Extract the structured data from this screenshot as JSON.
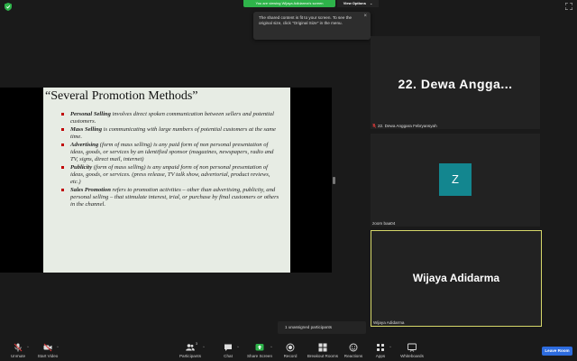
{
  "topbar": {
    "banner_text": "You are viewing Wijaya Adidarma's screen",
    "view_options_label": "View Options",
    "accent_color": "#2eb34a"
  },
  "tooltip": {
    "text": "The shared content is fit to your screen. To see the original size, click \"Original Size\" in the menu."
  },
  "slide": {
    "title": "“Several Promotion Methods”",
    "bullets": [
      {
        "term": "Personal Selling",
        "text": " involves direct spoken communication between sellers and potential customers."
      },
      {
        "term": "Mass Selling",
        "text": " is communicating with large numbers of potential customers at the same time."
      },
      {
        "term": "Advertising",
        "text": " (form of mass selling) is any paid form of non personal presentation of ideas, goods, or services by an identified sponsor (magazines, newspapers, radio and TV, signs, direct mail, internet)"
      },
      {
        "term": "Publicity",
        "text": " (form of mass selling) is any unpaid form of non personal presentation of ideas, goods, or services. (press release, TV talk show, advertorial, product reviews, etc.)"
      },
      {
        "term": "Sales Promotion",
        "text": " refers to promotion activities – other than advertising, publicity, and personal selling – that stimulate interest, trial, or purchase by final customers or others in the channel."
      }
    ]
  },
  "gallery": {
    "tile1": {
      "display_name": "22. Dewa Angga...",
      "label": "22. Dewa Anggara Febryansyah"
    },
    "tile2": {
      "avatar_letter": "Z",
      "label": "zoom baa04",
      "avatar_color": "#13868f"
    },
    "tile3": {
      "display_name": "Wijaya Adidarma",
      "label": "Wijaya Adidarma",
      "highlight_color": "#d6d76a"
    }
  },
  "toast": {
    "text": "1 unassigned participants"
  },
  "toolbar": {
    "unmute": "Unmute",
    "start_video": "Start Video",
    "participants": "Participants",
    "participants_count": "3",
    "chat": "Chat",
    "share_screen": "Share Screen",
    "record": "Record",
    "breakout_rooms": "Breakout Rooms",
    "reactions": "Reactions",
    "apps": "Apps",
    "whiteboards": "Whiteboards",
    "leave": "Leave Room"
  }
}
